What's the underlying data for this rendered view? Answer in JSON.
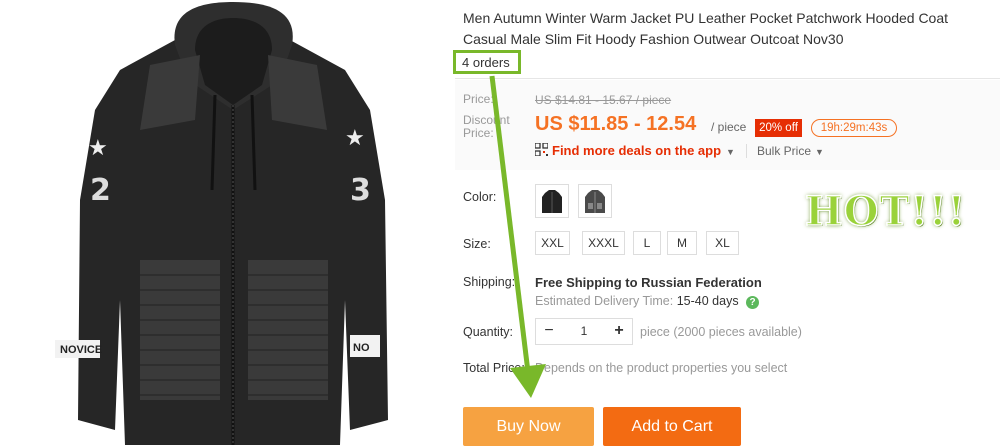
{
  "product": {
    "title": "Men Autumn Winter Warm Jacket PU Leather Pocket Patchwork Hooded Coat Casual Male Slim Fit Hoody Fashion Outwear Outcoat Nov30",
    "orders": "4 orders",
    "image": {
      "left_sleeve_text": "NOVICE",
      "right_sleeve_text": "NO"
    }
  },
  "price": {
    "label": "Price:",
    "original": "US $14.81 - 15.67 / piece",
    "discount_label_line1": "Discount",
    "discount_label_line2": "Price:",
    "discount": "US $11.85 - 12.54",
    "per_piece": "/ piece",
    "off_badge": "20% off",
    "timer": "19h:29m:43s",
    "deals_link": "Find more deals on the app",
    "bulk_price": "Bulk Price"
  },
  "color": {
    "label": "Color:"
  },
  "size": {
    "label": "Size:",
    "options": [
      "XXL",
      "XXXL",
      "L",
      "M",
      "XL"
    ]
  },
  "promo": {
    "hot_text": "HOT!!!"
  },
  "shipping": {
    "label": "Shipping:",
    "main": "Free Shipping to Russian Federation",
    "delivery_label": "Estimated Delivery Time:",
    "delivery_days": "15-40 days"
  },
  "quantity": {
    "label": "Quantity:",
    "value": "1",
    "available": "piece (2000 pieces available)"
  },
  "total": {
    "label": "Total Price:",
    "note": "Depends on the product properties you select"
  },
  "buttons": {
    "buy_now": "Buy Now",
    "add_to_cart": "Add to Cart"
  },
  "colors": {
    "accent_orange": "#f57224",
    "badge_red": "#e62e04",
    "buy_now_bg": "#f6a241",
    "add_cart_bg": "#f36b12",
    "annotation_green": "#79b82a"
  }
}
